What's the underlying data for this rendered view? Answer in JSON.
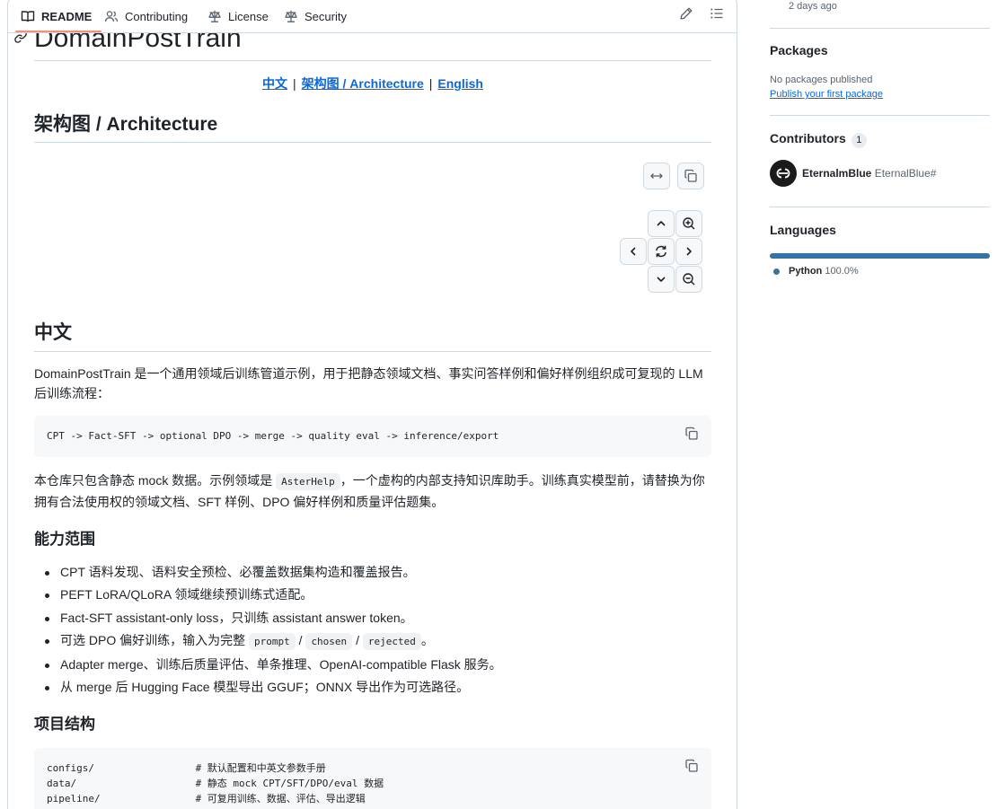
{
  "tabs": [
    {
      "label": "README",
      "icon": "book-icon",
      "active": true
    },
    {
      "label": "Contributing",
      "icon": "people-icon"
    },
    {
      "label": "License",
      "icon": "law-scale-icon"
    },
    {
      "label": "Security",
      "icon": "law-scale-icon"
    }
  ],
  "toolbar": {
    "edit_icon": "pencil-icon",
    "outline_icon": "list-unordered-icon"
  },
  "readme": {
    "title": "DomainPostTrain",
    "lang_links": [
      "中文",
      "架构图 / Architecture",
      "English"
    ],
    "lang_sep": "|",
    "architecture_heading": "架构图 / Architecture",
    "zh_heading": "中文",
    "intro": "DomainPostTrain 是一个通用领域后训练管道示例，用于把静态领域文档、事实问答样例和偏好样例组织成可复现的 LLM 后训练流程：",
    "pipeline_code": "CPT -> Fact-SFT -> optional DPO -> merge -> quality eval -> inference/export",
    "mock_text_1": "本仓库只包含静态 mock 数据。示例领域是",
    "mock_code": "AsterHelp",
    "mock_text_2": "，一个虚构的内部支持知识库助手。训练真实模型前，请替换为你拥有合法使用权的领域文档、SFT 样例、DPO 偏好样例和质量评估题集。",
    "capabilities_heading": "能力范围",
    "features": [
      "CPT 语料发现、语料安全预检、必覆盖数据集构造和覆盖报告。",
      "PEFT LoRA/QLoRA 领域继续预训练式适配。",
      "Fact-SFT assistant-only loss，只训练 assistant answer token。"
    ],
    "dpo_feature": {
      "prefix": "可选 DPO 偏好训练，输入为完整",
      "codes": [
        "prompt",
        "chosen",
        "rejected"
      ],
      "sep": "/",
      "suffix": "。"
    },
    "features_tail": [
      "Adapter merge、训练后质量评估、单条推理、OpenAI-compatible Flask 服务。",
      "从 merge 后 Hugging Face 模型导出 GGUF；ONNX 导出作为可选路径。"
    ],
    "structure_heading": "项目结构",
    "structure_code": "configs/                 # 默认配置和中英文参数手册\ndata/                    # 静态 mock CPT/SFT/DPO/eval 数据\npipeline/                # 可复用训练、数据、评估、导出逻辑"
  },
  "sidebar": {
    "release_time": "2 days ago",
    "packages_heading": "Packages",
    "packages_empty": "No packages published",
    "packages_link": "Publish your first package",
    "contributors_heading": "Contributors",
    "contributors_count": "1",
    "contributor_name": "EternalmBlue",
    "contributor_handle": "EternalBlue#",
    "languages_heading": "Languages",
    "language_name": "Python",
    "language_percent": "100.0%",
    "language_color": "#3572a5",
    "language_fraction": 1.0
  }
}
